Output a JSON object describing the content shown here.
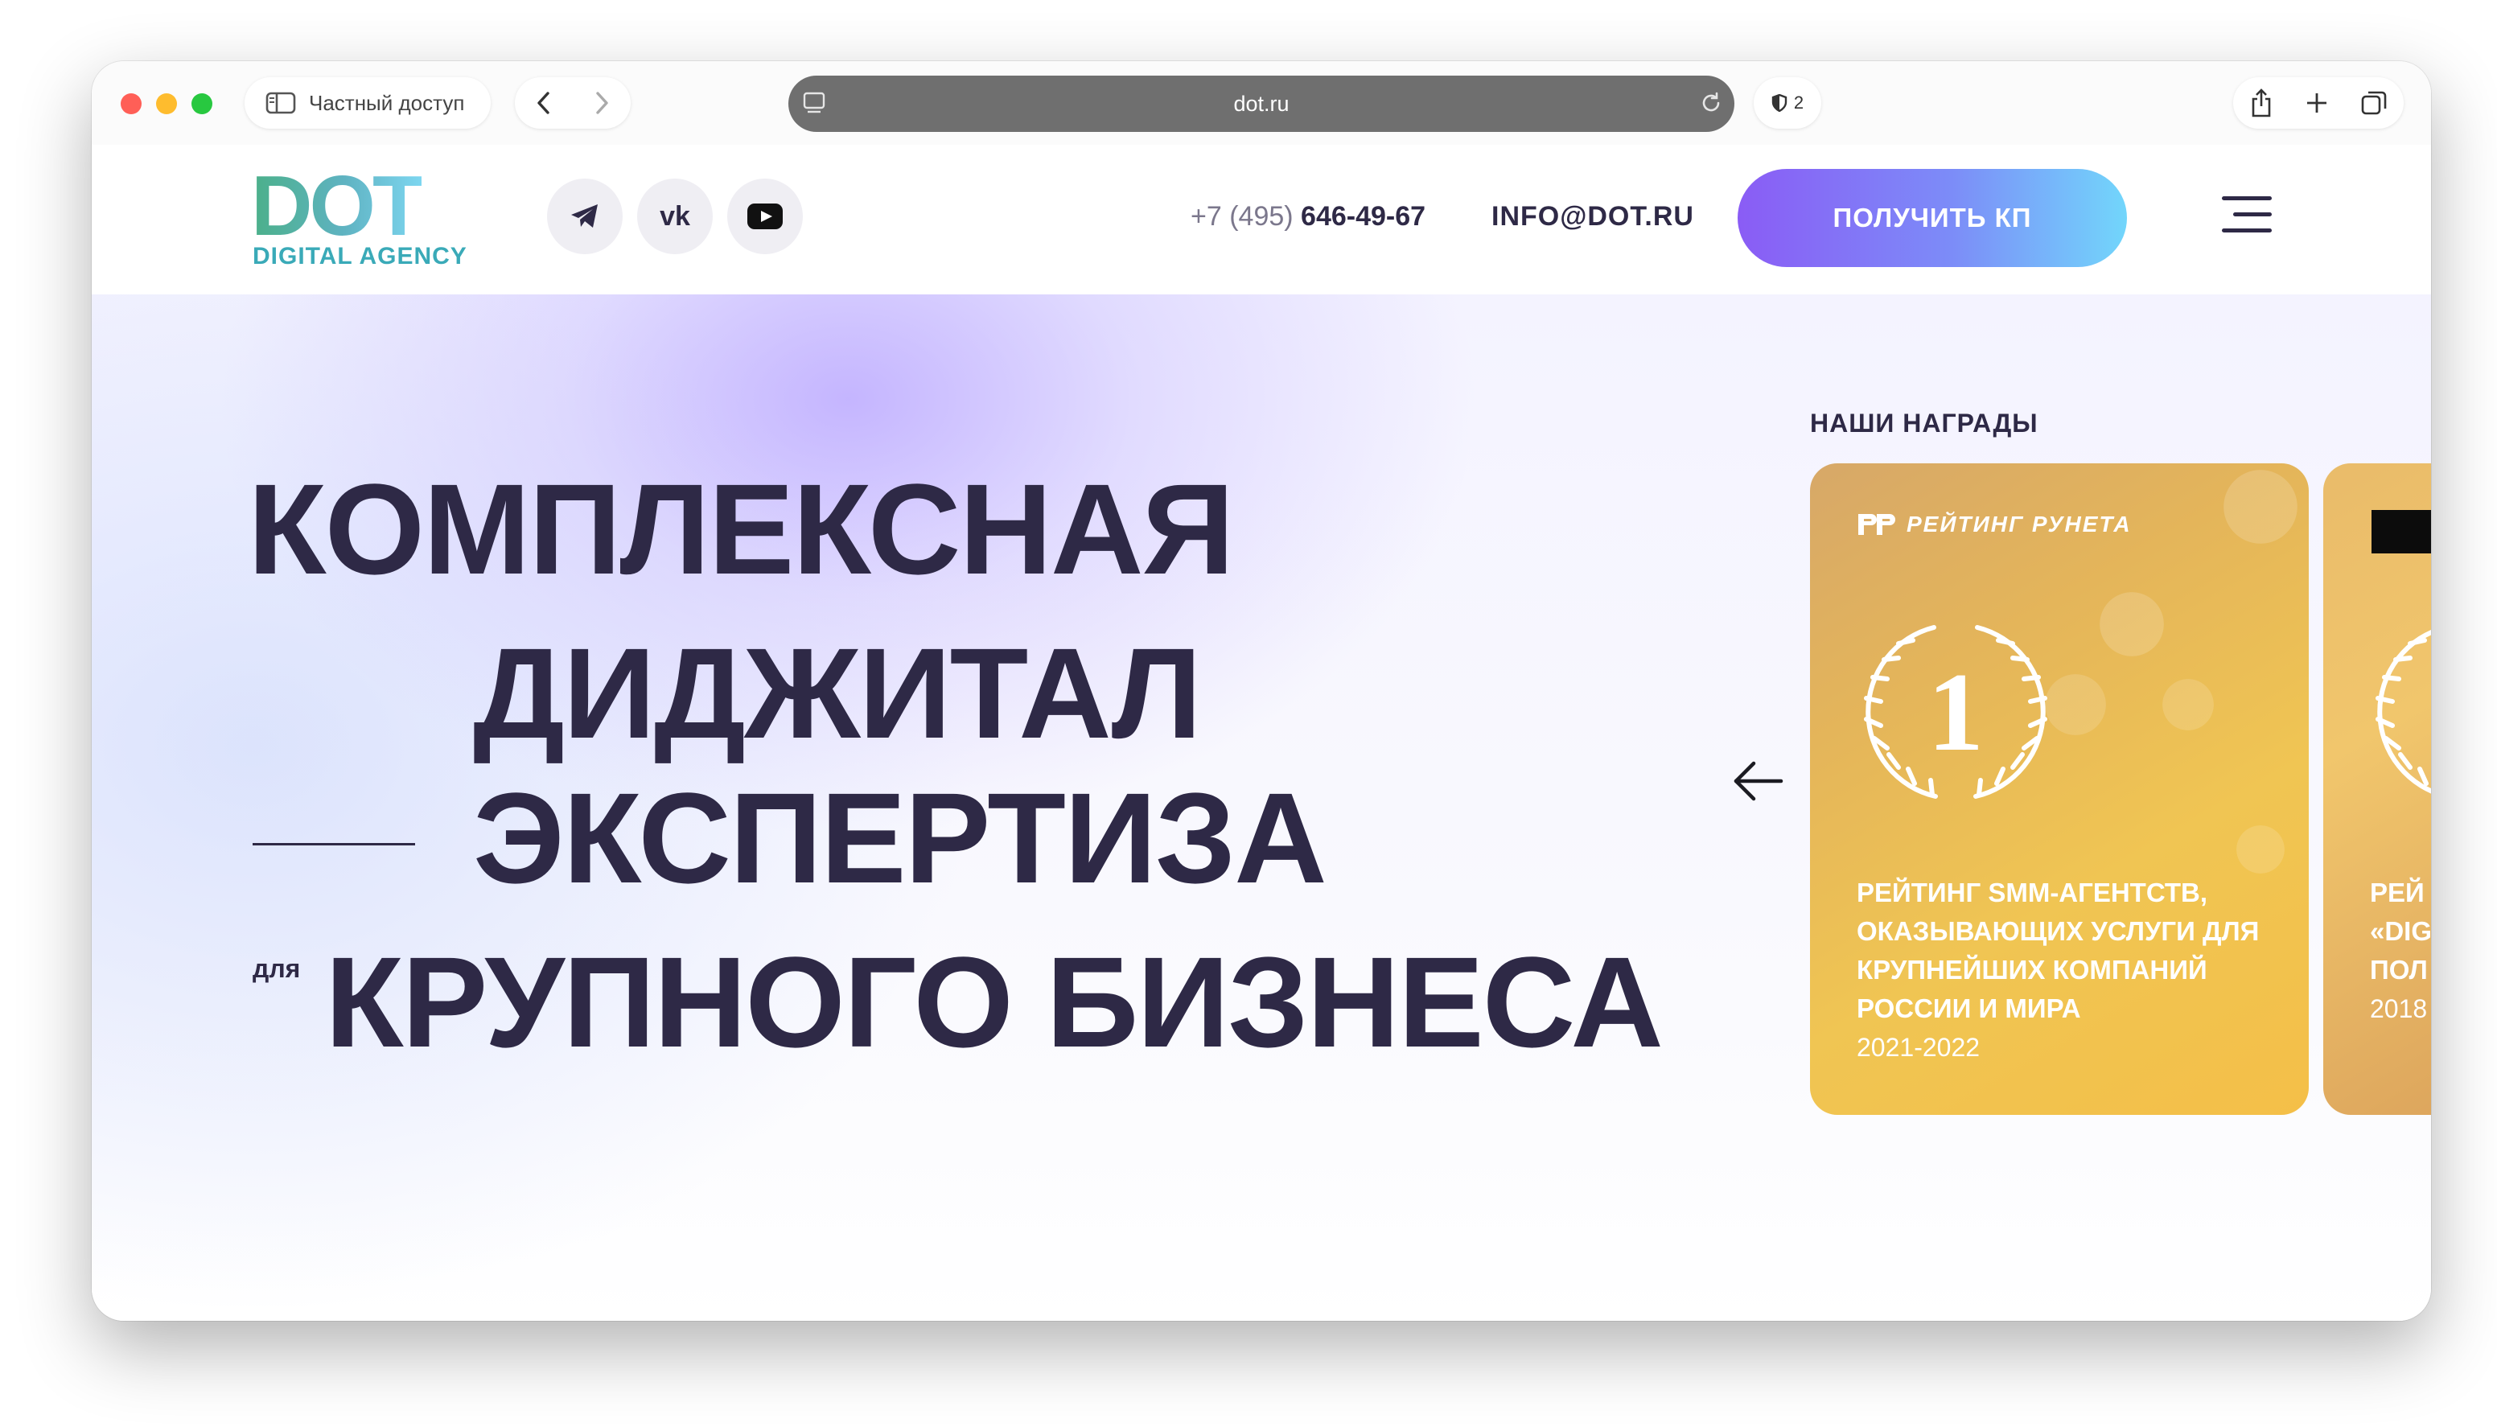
{
  "browser": {
    "private_label": "Частный доступ",
    "url": "dot.ru",
    "shield_count": "2"
  },
  "header": {
    "logo_main": "DOT",
    "logo_sub": "DIGITAL AGENCY",
    "social": [
      "telegram-icon",
      "vk-icon",
      "youtube-icon"
    ],
    "vk_label": "vk",
    "phone_prefix": "+7 (495)",
    "phone_number": "646-49-67",
    "email": "INFO@DOT.RU",
    "cta_label": "ПОЛУЧИТЬ КП"
  },
  "hero": {
    "line1": "КОМПЛЕКСНАЯ",
    "line2": "ДИДЖИТАЛ",
    "line3": "ЭКСПЕРТИЗА",
    "for_label": "для",
    "line4": "КРУПНОГО БИЗНЕСА"
  },
  "awards": {
    "title": "НАШИ НАГРАДЫ",
    "cards": [
      {
        "brand": "РЕЙТИНГ РУНЕТА",
        "place": "1",
        "title": "РЕЙТИНГ SMM-АГЕНТСТВ, ОКАЗЫВАЮЩИХ УСЛУГИ ДЛЯ КРУПНЕЙШИХ КОМПАНИЙ РОССИИ И МИРА",
        "years": "2021-2022"
      },
      {
        "line1": "РЕЙ",
        "line2": "«DIG",
        "line3": "ПОЛ",
        "year": "2018"
      }
    ]
  },
  "colors": {
    "ink": "#2e2946",
    "cta_from": "#8a5cf5",
    "cta_to": "#72d6fb",
    "gold": "#f0c553"
  }
}
